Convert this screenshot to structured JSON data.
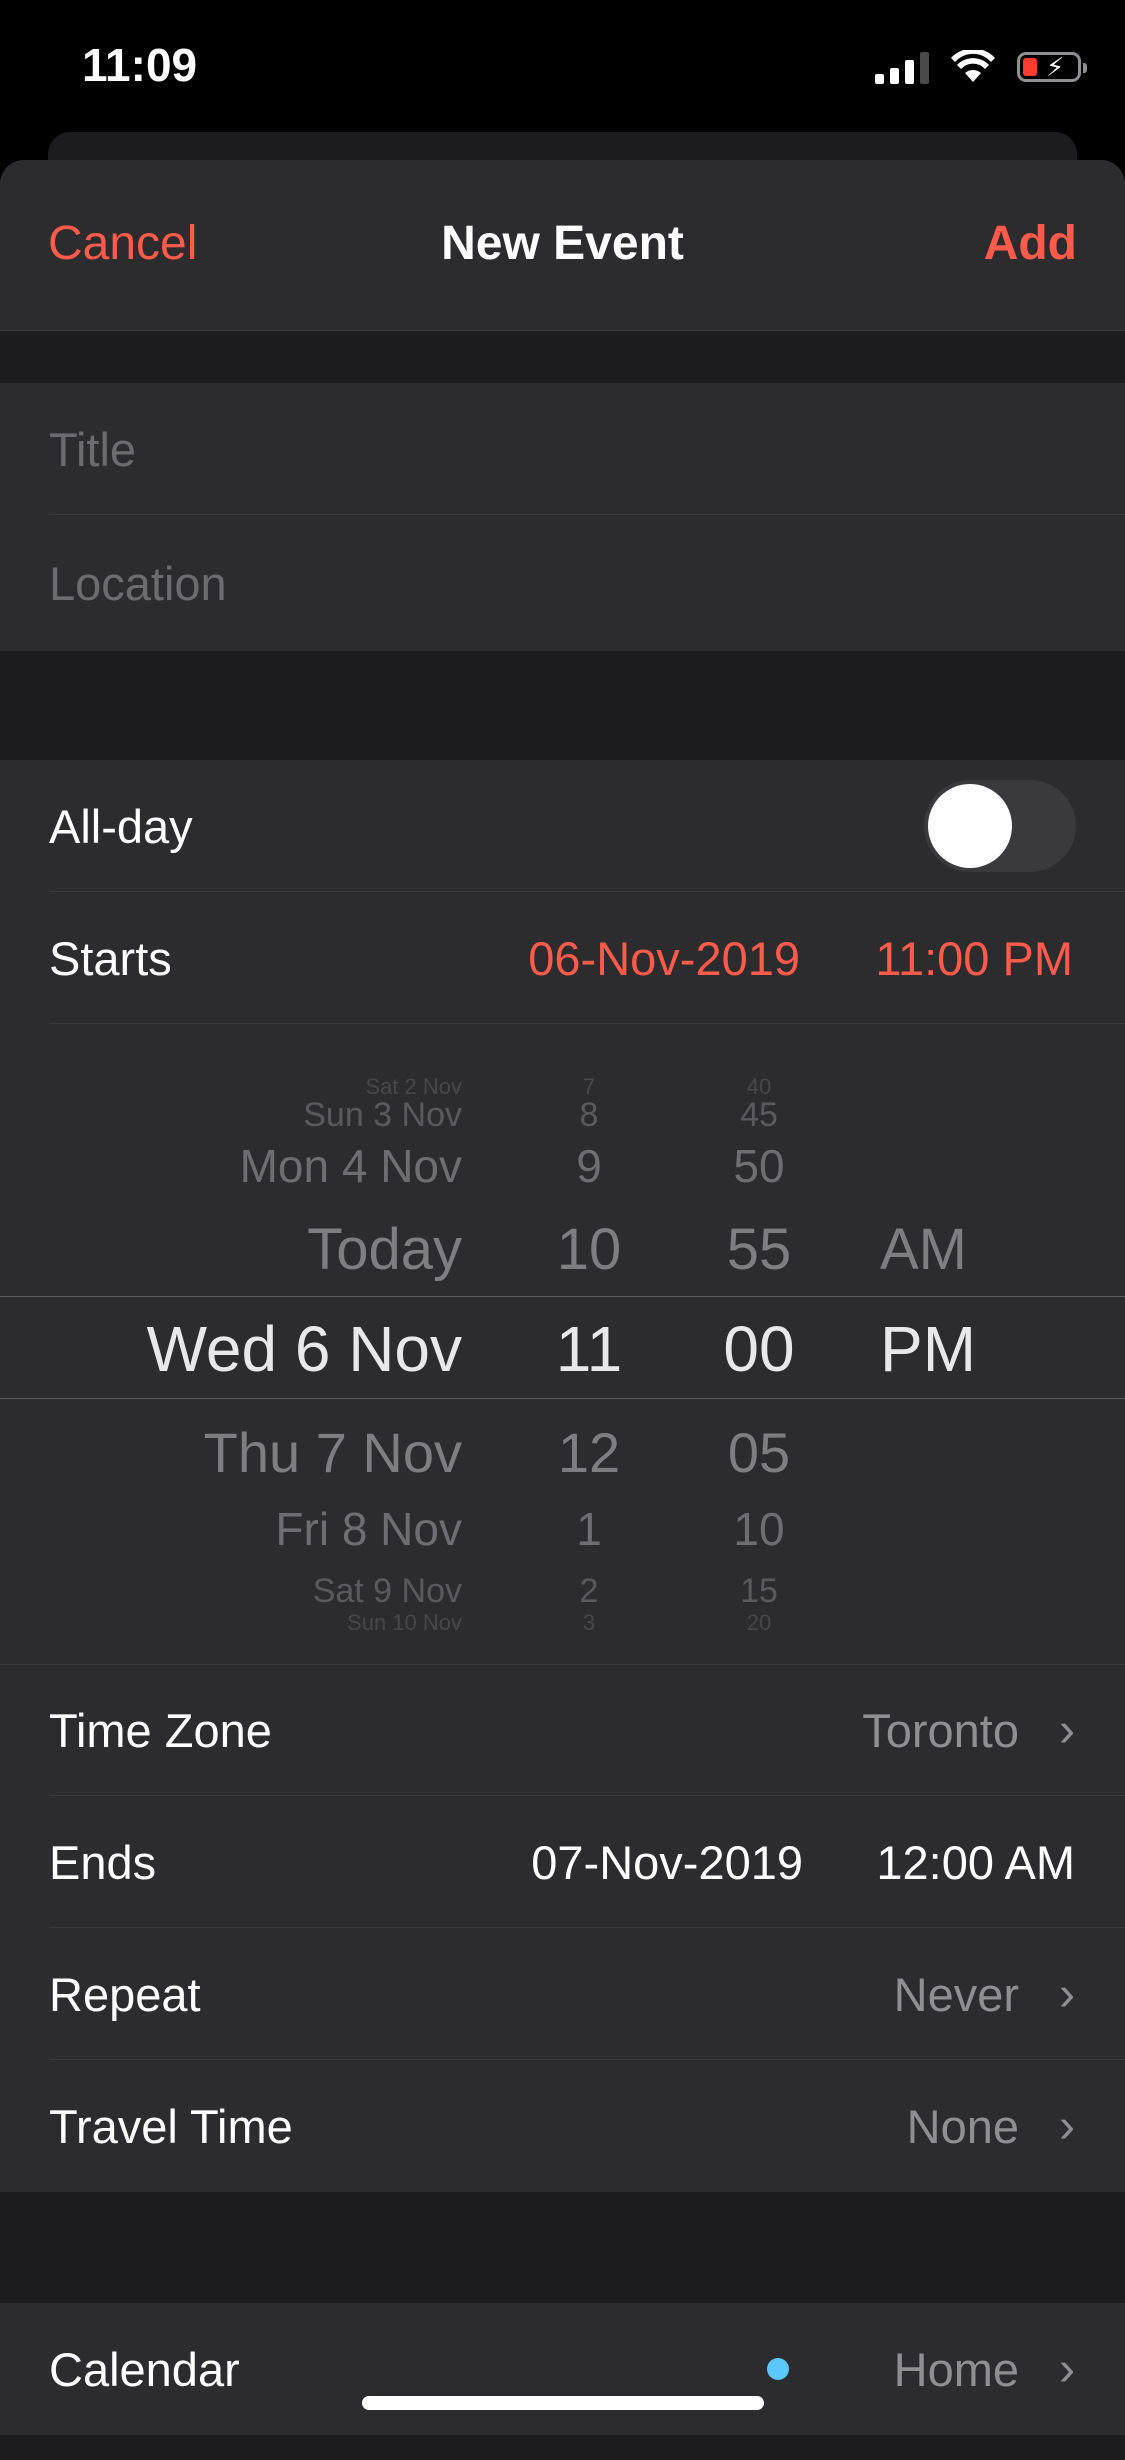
{
  "status_bar": {
    "time": "11:09"
  },
  "nav": {
    "cancel": "Cancel",
    "title": "New Event",
    "add": "Add"
  },
  "fields": {
    "title_placeholder": "Title",
    "location_placeholder": "Location"
  },
  "all_day": {
    "label": "All-day",
    "on": false
  },
  "starts": {
    "label": "Starts",
    "date": "06-Nov-2019",
    "time": "11:00 PM"
  },
  "picker": {
    "dates": [
      "Sat 2 Nov",
      "Sun 3 Nov",
      "Mon 4 Nov",
      "Today",
      "Wed 6 Nov",
      "Thu 7 Nov",
      "Fri 8 Nov",
      "Sat 9 Nov",
      "Sun 10 Nov"
    ],
    "hours": [
      "7",
      "8",
      "9",
      "10",
      "11",
      "12",
      "1",
      "2",
      "3"
    ],
    "minutes": [
      "40",
      "45",
      "50",
      "55",
      "00",
      "05",
      "10",
      "15",
      "20"
    ],
    "ampm": [
      "AM",
      "PM"
    ]
  },
  "time_zone": {
    "label": "Time Zone",
    "value": "Toronto"
  },
  "ends": {
    "label": "Ends",
    "date": "07-Nov-2019",
    "time": "12:00 AM"
  },
  "repeat": {
    "label": "Repeat",
    "value": "Never"
  },
  "travel_time": {
    "label": "Travel Time",
    "value": "None"
  },
  "calendar": {
    "label": "Calendar",
    "value": "Home",
    "dot_color": "#5ac8fa"
  },
  "colors": {
    "accent": "#ff5a4a",
    "background": "#1c1c1e",
    "cell": "#2c2c2e"
  }
}
